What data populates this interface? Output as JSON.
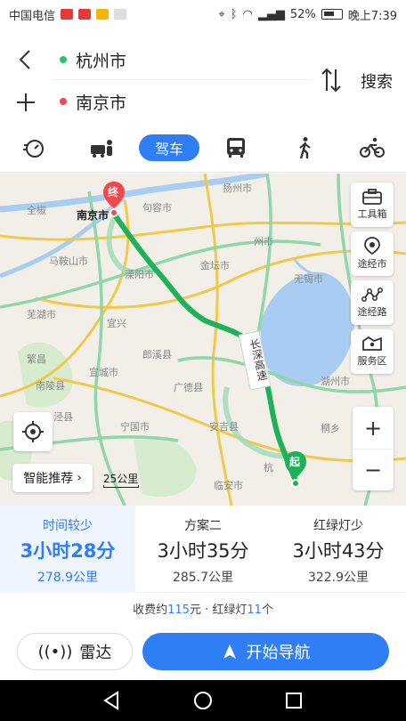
{
  "status_bar": {
    "carrier": "中国电信",
    "battery": "52%",
    "clock": "晚上7:39"
  },
  "route_input": {
    "start": "杭州市",
    "end": "南京市",
    "search_label": "搜索"
  },
  "modes": {
    "drive_label": "驾车"
  },
  "map": {
    "labels": {
      "nanjing": "南京市",
      "jurong": "句容市",
      "hangzhou_city": "州市",
      "wuxi": "无锡市",
      "liyang": "溧阳市",
      "jintan": "金坛市",
      "maanshan": "马鞍山市",
      "wuhu": "芜湖市",
      "langxi": "郎溪县",
      "guangde": "广德县",
      "ningguo": "宁国市",
      "anji": "安吉县",
      "linan": "临安市",
      "yangzhou": "扬州市",
      "huzhou": "湖州市",
      "xuanzhou": "宣城市",
      "quanjiao": "全椒",
      "nanling": "南陵县",
      "jingxian": "泾县",
      "fanchang": "繁昌",
      "xianning": "宜兴",
      "jiashan": "桐乡",
      "hang": "杭"
    },
    "end_marker": "终",
    "start_marker": "起",
    "highway_label": "长深高速",
    "tools": {
      "toolbox": "工具箱",
      "via_city": "途经市",
      "via_road": "途经路",
      "service": "服务区"
    },
    "zoom_in": "+",
    "zoom_out": "−",
    "smart_recommend": "智能推荐",
    "scale": "25公里"
  },
  "routes": [
    {
      "label": "时间较少",
      "duration": "3小时28分",
      "distance": "278.9公里"
    },
    {
      "label": "方案二",
      "duration": "3小时35分",
      "distance": "285.7公里"
    },
    {
      "label": "红绿灯少",
      "duration": "3小时43分",
      "distance": "322.9公里"
    }
  ],
  "fee": {
    "prefix": "收费约",
    "amount": "115",
    "mid": "元 · 红绿灯",
    "lights": "11",
    "suffix": "个"
  },
  "actions": {
    "radar": "雷达",
    "navigate": "开始导航"
  },
  "colors": {
    "accent": "#2e7ef5",
    "route": "#2cc36b",
    "end_marker": "#f2484b"
  }
}
